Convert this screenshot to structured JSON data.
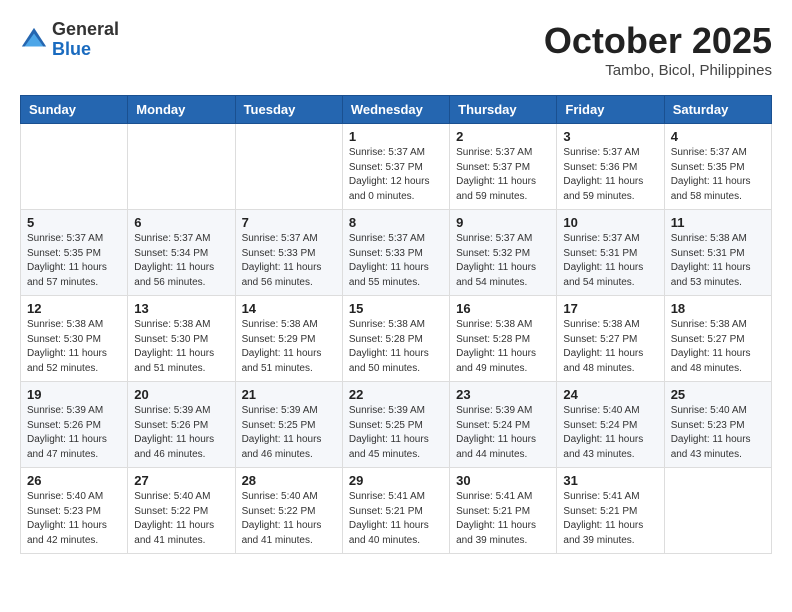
{
  "header": {
    "logo_general": "General",
    "logo_blue": "Blue",
    "month_title": "October 2025",
    "location": "Tambo, Bicol, Philippines"
  },
  "weekdays": [
    "Sunday",
    "Monday",
    "Tuesday",
    "Wednesday",
    "Thursday",
    "Friday",
    "Saturday"
  ],
  "weeks": [
    [
      {
        "day": "",
        "info": ""
      },
      {
        "day": "",
        "info": ""
      },
      {
        "day": "",
        "info": ""
      },
      {
        "day": "1",
        "info": "Sunrise: 5:37 AM\nSunset: 5:37 PM\nDaylight: 12 hours\nand 0 minutes."
      },
      {
        "day": "2",
        "info": "Sunrise: 5:37 AM\nSunset: 5:37 PM\nDaylight: 11 hours\nand 59 minutes."
      },
      {
        "day": "3",
        "info": "Sunrise: 5:37 AM\nSunset: 5:36 PM\nDaylight: 11 hours\nand 59 minutes."
      },
      {
        "day": "4",
        "info": "Sunrise: 5:37 AM\nSunset: 5:35 PM\nDaylight: 11 hours\nand 58 minutes."
      }
    ],
    [
      {
        "day": "5",
        "info": "Sunrise: 5:37 AM\nSunset: 5:35 PM\nDaylight: 11 hours\nand 57 minutes."
      },
      {
        "day": "6",
        "info": "Sunrise: 5:37 AM\nSunset: 5:34 PM\nDaylight: 11 hours\nand 56 minutes."
      },
      {
        "day": "7",
        "info": "Sunrise: 5:37 AM\nSunset: 5:33 PM\nDaylight: 11 hours\nand 56 minutes."
      },
      {
        "day": "8",
        "info": "Sunrise: 5:37 AM\nSunset: 5:33 PM\nDaylight: 11 hours\nand 55 minutes."
      },
      {
        "day": "9",
        "info": "Sunrise: 5:37 AM\nSunset: 5:32 PM\nDaylight: 11 hours\nand 54 minutes."
      },
      {
        "day": "10",
        "info": "Sunrise: 5:37 AM\nSunset: 5:31 PM\nDaylight: 11 hours\nand 54 minutes."
      },
      {
        "day": "11",
        "info": "Sunrise: 5:38 AM\nSunset: 5:31 PM\nDaylight: 11 hours\nand 53 minutes."
      }
    ],
    [
      {
        "day": "12",
        "info": "Sunrise: 5:38 AM\nSunset: 5:30 PM\nDaylight: 11 hours\nand 52 minutes."
      },
      {
        "day": "13",
        "info": "Sunrise: 5:38 AM\nSunset: 5:30 PM\nDaylight: 11 hours\nand 51 minutes."
      },
      {
        "day": "14",
        "info": "Sunrise: 5:38 AM\nSunset: 5:29 PM\nDaylight: 11 hours\nand 51 minutes."
      },
      {
        "day": "15",
        "info": "Sunrise: 5:38 AM\nSunset: 5:28 PM\nDaylight: 11 hours\nand 50 minutes."
      },
      {
        "day": "16",
        "info": "Sunrise: 5:38 AM\nSunset: 5:28 PM\nDaylight: 11 hours\nand 49 minutes."
      },
      {
        "day": "17",
        "info": "Sunrise: 5:38 AM\nSunset: 5:27 PM\nDaylight: 11 hours\nand 48 minutes."
      },
      {
        "day": "18",
        "info": "Sunrise: 5:38 AM\nSunset: 5:27 PM\nDaylight: 11 hours\nand 48 minutes."
      }
    ],
    [
      {
        "day": "19",
        "info": "Sunrise: 5:39 AM\nSunset: 5:26 PM\nDaylight: 11 hours\nand 47 minutes."
      },
      {
        "day": "20",
        "info": "Sunrise: 5:39 AM\nSunset: 5:26 PM\nDaylight: 11 hours\nand 46 minutes."
      },
      {
        "day": "21",
        "info": "Sunrise: 5:39 AM\nSunset: 5:25 PM\nDaylight: 11 hours\nand 46 minutes."
      },
      {
        "day": "22",
        "info": "Sunrise: 5:39 AM\nSunset: 5:25 PM\nDaylight: 11 hours\nand 45 minutes."
      },
      {
        "day": "23",
        "info": "Sunrise: 5:39 AM\nSunset: 5:24 PM\nDaylight: 11 hours\nand 44 minutes."
      },
      {
        "day": "24",
        "info": "Sunrise: 5:40 AM\nSunset: 5:24 PM\nDaylight: 11 hours\nand 43 minutes."
      },
      {
        "day": "25",
        "info": "Sunrise: 5:40 AM\nSunset: 5:23 PM\nDaylight: 11 hours\nand 43 minutes."
      }
    ],
    [
      {
        "day": "26",
        "info": "Sunrise: 5:40 AM\nSunset: 5:23 PM\nDaylight: 11 hours\nand 42 minutes."
      },
      {
        "day": "27",
        "info": "Sunrise: 5:40 AM\nSunset: 5:22 PM\nDaylight: 11 hours\nand 41 minutes."
      },
      {
        "day": "28",
        "info": "Sunrise: 5:40 AM\nSunset: 5:22 PM\nDaylight: 11 hours\nand 41 minutes."
      },
      {
        "day": "29",
        "info": "Sunrise: 5:41 AM\nSunset: 5:21 PM\nDaylight: 11 hours\nand 40 minutes."
      },
      {
        "day": "30",
        "info": "Sunrise: 5:41 AM\nSunset: 5:21 PM\nDaylight: 11 hours\nand 39 minutes."
      },
      {
        "day": "31",
        "info": "Sunrise: 5:41 AM\nSunset: 5:21 PM\nDaylight: 11 hours\nand 39 minutes."
      },
      {
        "day": "",
        "info": ""
      }
    ]
  ]
}
